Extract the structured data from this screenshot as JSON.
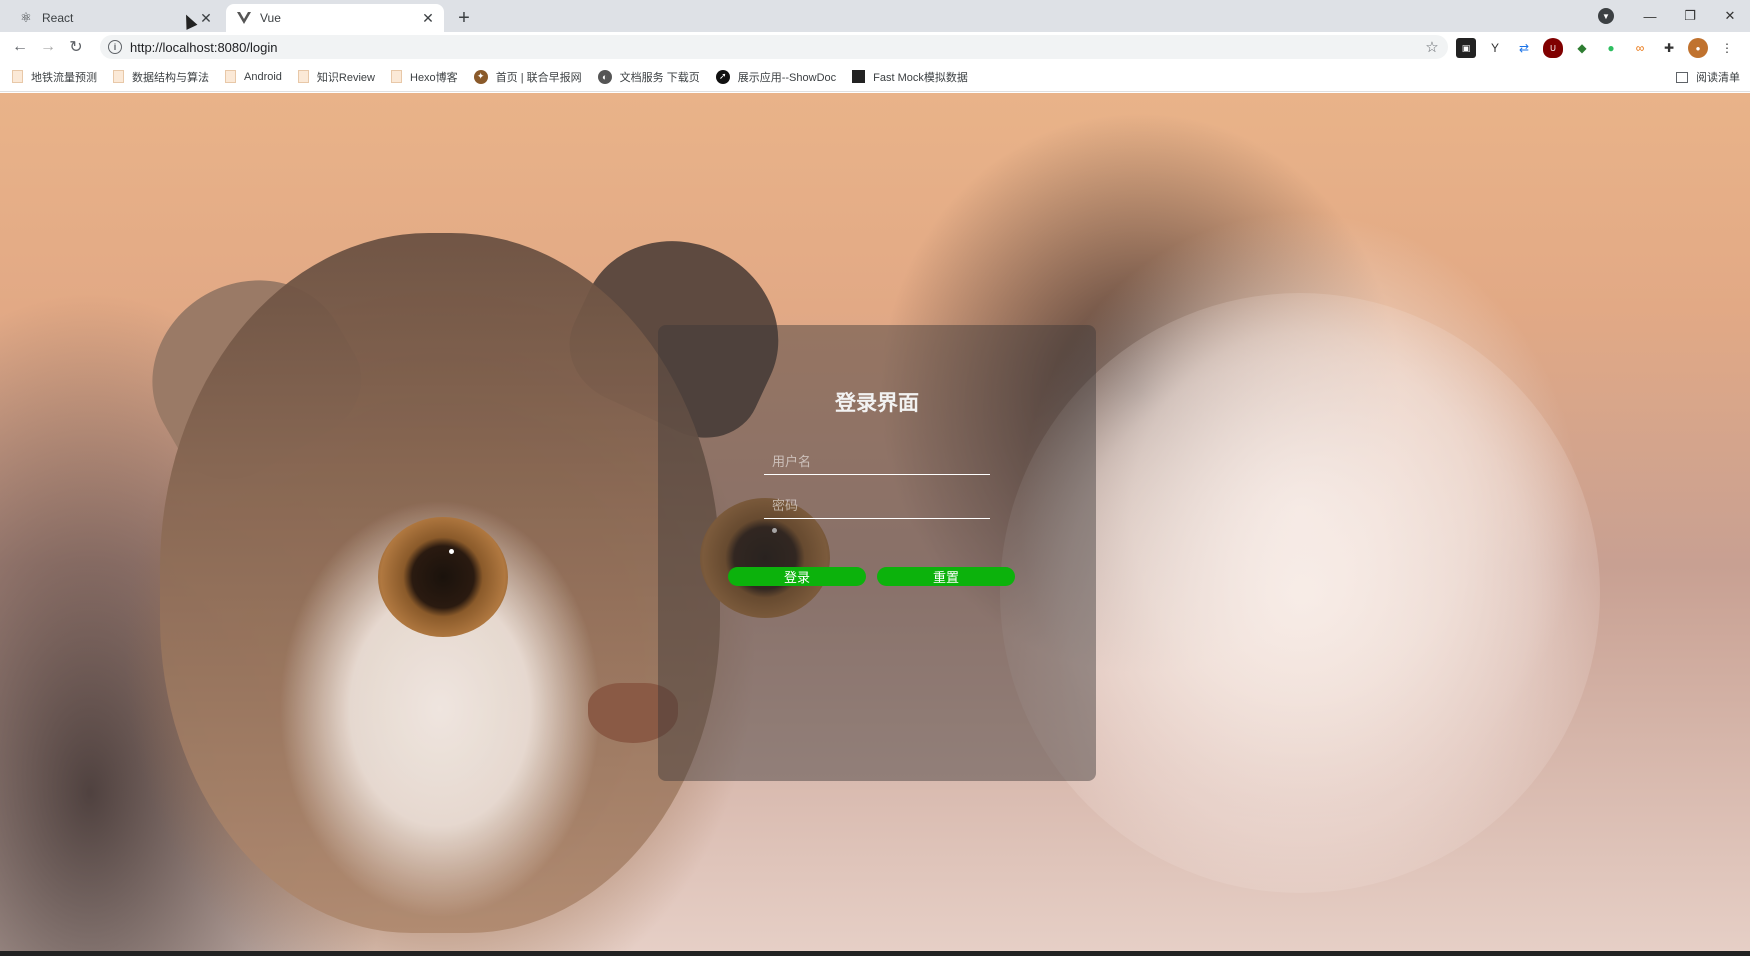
{
  "tabs": [
    {
      "title": "React",
      "active": false,
      "icon": "react-icon"
    },
    {
      "title": "Vue",
      "active": true,
      "icon": "vue-icon"
    }
  ],
  "toolbar": {
    "url": "http://localhost:8080/login"
  },
  "bookmarks": [
    {
      "label": "地铁流量预测",
      "icon": "folder-icon"
    },
    {
      "label": "数据结构与算法",
      "icon": "folder-icon"
    },
    {
      "label": "Android",
      "icon": "folder-icon"
    },
    {
      "label": "知识Review",
      "icon": "folder-icon"
    },
    {
      "label": "Hexo博客",
      "icon": "folder-icon"
    },
    {
      "label": "首页 | 联合早报网",
      "icon": "globe-icon"
    },
    {
      "label": "文档服务 下载页",
      "icon": "globe-icon"
    },
    {
      "label": "展示应用--ShowDoc",
      "icon": "compass-icon"
    },
    {
      "label": "Fast Mock模拟数据",
      "icon": "square-icon"
    }
  ],
  "reading_list": "阅读清单",
  "login": {
    "title": "登录界面",
    "username_placeholder": "用户名",
    "password_placeholder": "密码",
    "login_label": "登录",
    "reset_label": "重置",
    "button_color": "#0cb20c"
  }
}
